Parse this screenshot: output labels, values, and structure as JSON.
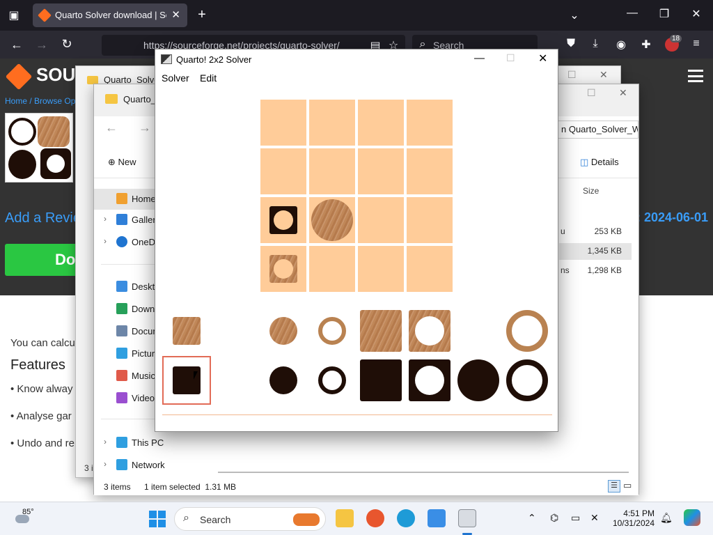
{
  "browser": {
    "tab_title": "Quarto Solver download | Sourc",
    "url": "https://sourceforge.net/projects/quarto-solver/",
    "search_placeholder": "Search",
    "badge_count": "18"
  },
  "site": {
    "brand": "SOUR",
    "breadcrumb": "Home / Browse Op",
    "add_review": "Add a Revie",
    "download_label": "Do",
    "date_right": ": 2024-06-01",
    "intro": "You can calcu",
    "features_heading": "Features",
    "bullets": [
      "• Know alway",
      "• Analyse gar",
      "• Undo and re"
    ]
  },
  "explorer_back": {
    "title": "Quarto_Solve"
  },
  "explorer": {
    "title": "Quarto_",
    "new_label": "New",
    "details_label": "Details",
    "size_header": "Size",
    "path_tail": "n Quarto_Solver_Wi",
    "nav": [
      {
        "label": "Home",
        "icon": "home-icon",
        "color": "#f0a030"
      },
      {
        "label": "Gallery",
        "icon": "gallery-icon",
        "color": "#2f7fd8"
      },
      {
        "label": "OneDriv",
        "icon": "onedrive-icon",
        "color": "#1f74d0"
      },
      {
        "label": "Desktop",
        "icon": "desktop-icon",
        "color": "#3b8de0"
      },
      {
        "label": "Downl",
        "icon": "downloads-icon",
        "color": "#27a05a"
      },
      {
        "label": "Docum",
        "icon": "documents-icon",
        "color": "#6d86a8"
      },
      {
        "label": "Pictur",
        "icon": "pictures-icon",
        "color": "#2f9fe0"
      },
      {
        "label": "Music",
        "icon": "music-icon",
        "color": "#e05a4a"
      },
      {
        "label": "Videos",
        "icon": "videos-icon",
        "color": "#9a4fd0"
      },
      {
        "label": "This PC",
        "icon": "thispc-icon",
        "color": "#2f9fe0"
      },
      {
        "label": "Network",
        "icon": "network-icon",
        "color": "#2f9fe0"
      }
    ],
    "files": [
      {
        "type": "u",
        "size": "253 KB"
      },
      {
        "type": "",
        "size": "1,345 KB"
      },
      {
        "type": "ns",
        "size": "1,298 KB"
      }
    ],
    "status_items": "3 items",
    "status_selected": "1 item selected  1.31 MB",
    "back_status": "3 i"
  },
  "quarto": {
    "title": "Quarto! 2x2 Solver",
    "menu": [
      "Solver",
      "Edit"
    ],
    "board_size": 4,
    "board_pieces": [
      {
        "row": 2,
        "col": 0,
        "kind": "dark-square-hole-small",
        "name": "dark-square-hollow-small-piece"
      },
      {
        "row": 2,
        "col": 1,
        "kind": "wood-circle-big",
        "name": "light-circle-solid-tall-piece"
      },
      {
        "row": 3,
        "col": 0,
        "kind": "wood-square-hole-small",
        "name": "light-square-hollow-small-piece"
      }
    ],
    "selected_piece": "dark-square-small"
  },
  "taskbar": {
    "weather_temp": "85°",
    "search_placeholder": "Search",
    "time": "4:51 PM",
    "date": "10/31/2024"
  }
}
